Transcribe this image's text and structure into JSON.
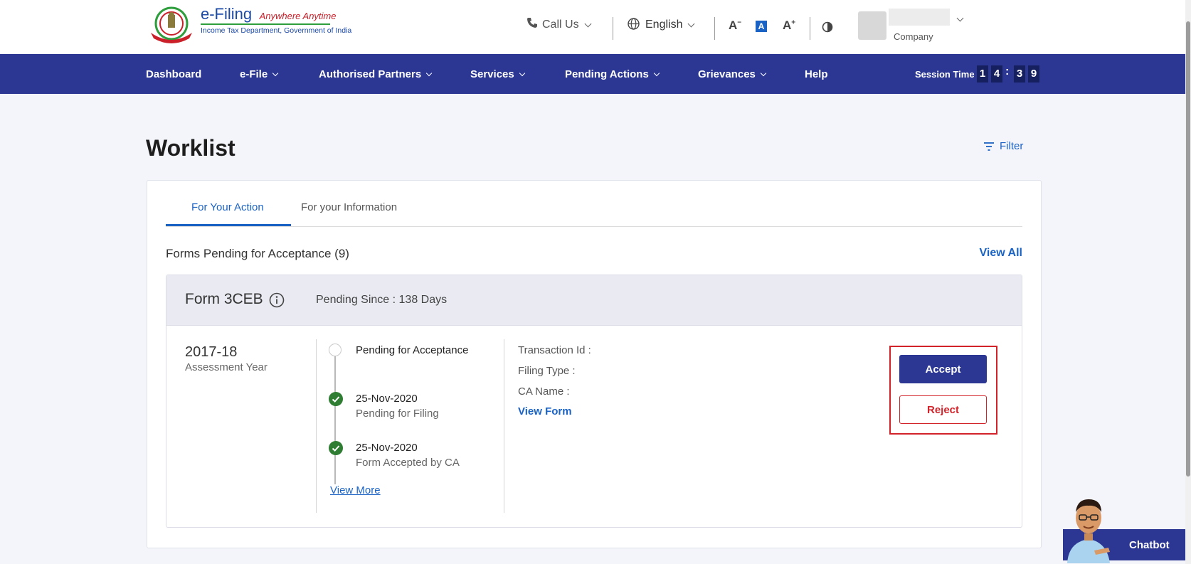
{
  "header": {
    "logo_title": "e-Filing",
    "logo_tagline": "Anywhere Anytime",
    "logo_subtitle": "Income Tax Department, Government of India",
    "call_us": "Call Us",
    "language": "English",
    "font_decrease": "A",
    "font_normal": "A",
    "font_increase": "A",
    "user_role": "Company"
  },
  "nav": {
    "items": [
      "Dashboard",
      "e-File",
      "Authorised Partners",
      "Services",
      "Pending Actions",
      "Grievances",
      "Help"
    ],
    "session_label": "Session Time",
    "session_digits": [
      "1",
      "4",
      "3",
      "9"
    ]
  },
  "page": {
    "title": "Worklist",
    "filter_label": "Filter"
  },
  "tabs": [
    {
      "label": "For Your Action",
      "active": true
    },
    {
      "label": "For your Information",
      "active": false
    }
  ],
  "section": {
    "title": "Forms Pending for Acceptance (9)",
    "view_all": "View All"
  },
  "form_card": {
    "form_name": "Form 3CEB",
    "pending_since": "Pending Since : 138 Days",
    "assessment_year": "2017-18",
    "assessment_year_label": "Assessment Year",
    "timeline": [
      {
        "title": "Pending for Acceptance",
        "sub": "",
        "done": false
      },
      {
        "title": "25-Nov-2020",
        "sub": "Pending for Filing",
        "done": true
      },
      {
        "title": "25-Nov-2020",
        "sub": "Form Accepted by CA",
        "done": true
      }
    ],
    "view_more": "View More",
    "details": {
      "transaction_id": "Transaction Id :",
      "filing_type": "Filing Type :",
      "ca_name": "CA Name :"
    },
    "view_form": "View Form",
    "accept": "Accept",
    "reject": "Reject"
  },
  "chatbot": {
    "label": "Chatbot"
  },
  "colors": {
    "nav_bg": "#2b3793",
    "link": "#1a63c5",
    "reject": "#d2232a",
    "check": "#2e7d32"
  }
}
